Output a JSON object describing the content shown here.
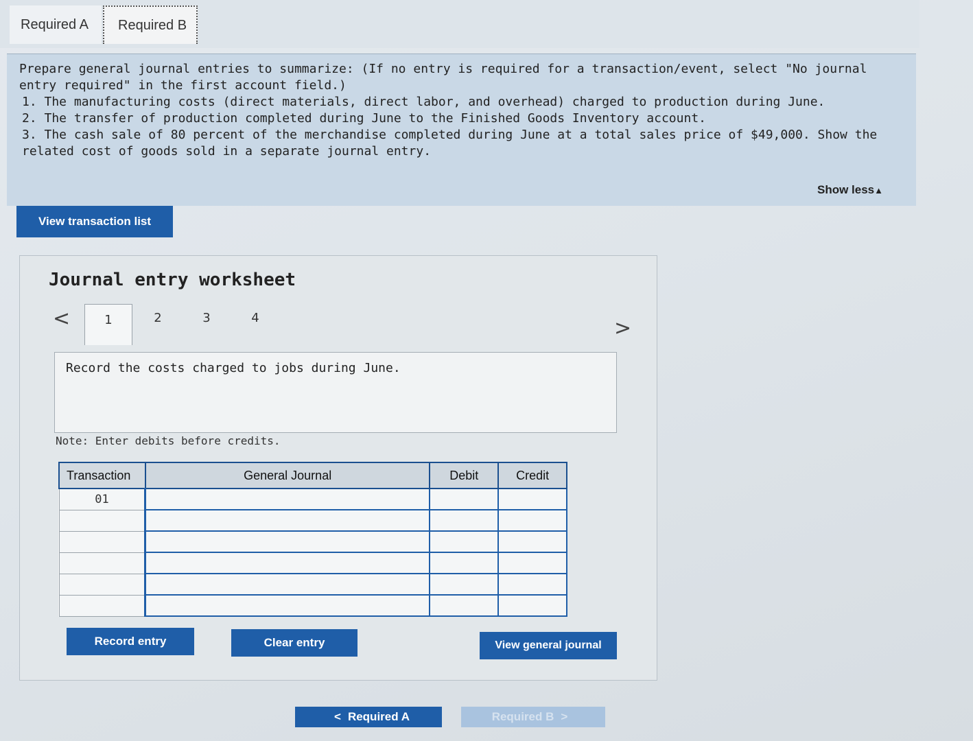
{
  "tabs": [
    {
      "label": "Required A"
    },
    {
      "label": "Required B"
    }
  ],
  "instructions": {
    "intro": "Prepare general journal entries to summarize: (If no entry is required for a transaction/event, select \"No journal entry required\" in the first account field.)",
    "items": [
      "1. The manufacturing costs (direct materials, direct labor, and overhead) charged to production during June.",
      "2. The transfer of production completed during June to the Finished Goods Inventory account.",
      "3. The cash sale of 80 percent of the merchandise completed during June at a total sales price of $49,000. Show the related cost of goods sold in a separate journal entry."
    ],
    "show_less": "Show less"
  },
  "buttons": {
    "view_transaction_list": "View transaction list",
    "record_entry": "Record entry",
    "clear_entry": "Clear entry",
    "view_general_journal": "View general journal"
  },
  "worksheet": {
    "title": "Journal entry worksheet",
    "nav_prev": "<",
    "nav_next": ">",
    "pages": [
      "1",
      "2",
      "3",
      "4"
    ],
    "active_page": "1",
    "description": "Record the costs charged to jobs during June.",
    "note": "Note: Enter debits before credits."
  },
  "journal": {
    "headers": {
      "transaction": "Transaction",
      "general_journal": "General Journal",
      "debit": "Debit",
      "credit": "Credit"
    },
    "rows": [
      {
        "transaction": "01",
        "account": "",
        "debit": "",
        "credit": ""
      },
      {
        "transaction": "",
        "account": "",
        "debit": "",
        "credit": ""
      },
      {
        "transaction": "",
        "account": "",
        "debit": "",
        "credit": ""
      },
      {
        "transaction": "",
        "account": "",
        "debit": "",
        "credit": ""
      },
      {
        "transaction": "",
        "account": "",
        "debit": "",
        "credit": ""
      },
      {
        "transaction": "",
        "account": "",
        "debit": "",
        "credit": ""
      }
    ]
  },
  "bottom_nav": {
    "prev_label": "Required A",
    "next_label": "Required B",
    "prev_icon": "chevron-left-icon",
    "next_icon": "chevron-right-icon"
  },
  "colors": {
    "primary_button": "#1f5ea8",
    "instructions_bg": "#c9d8e6",
    "disabled_button": "#a9c3df"
  }
}
